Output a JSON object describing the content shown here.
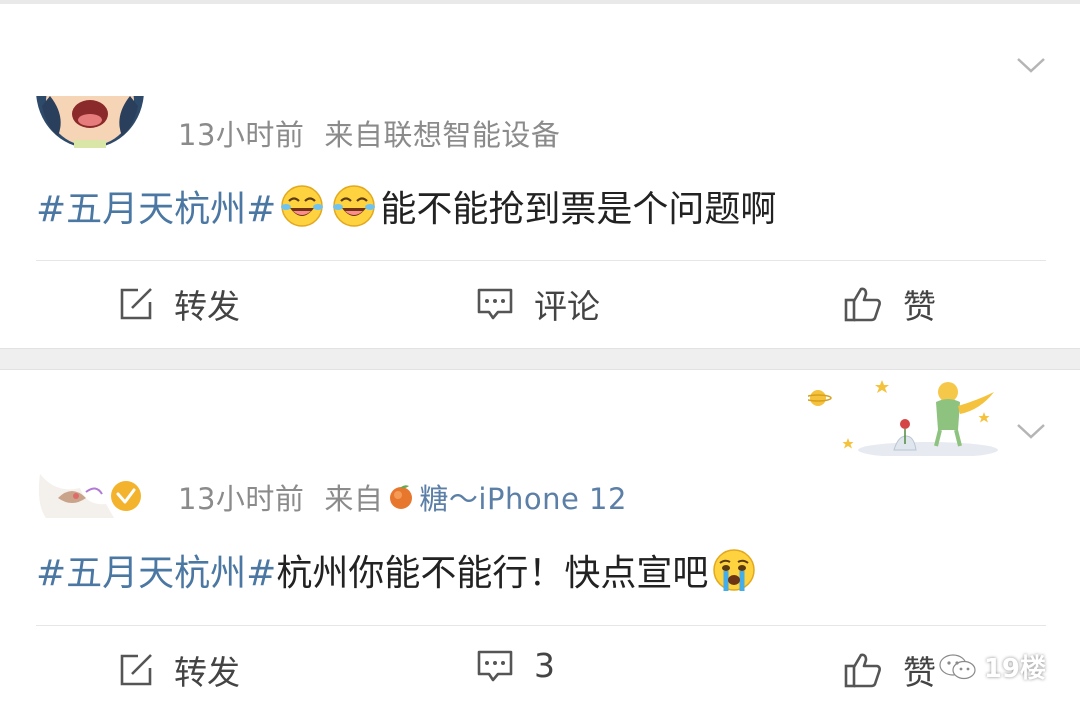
{
  "posts": [
    {
      "time": "13小时前",
      "source": "来自联想智能设备",
      "content": {
        "topic": "#五月天杭州#",
        "emojis": [
          "laugh-cry-emoji",
          "laugh-cry-emoji"
        ],
        "text": "能不能抢到票是个问题啊"
      },
      "actions": {
        "repost": "转发",
        "comment": "评论",
        "like": "赞"
      }
    },
    {
      "time": "13小时前",
      "source_prefix": "来自",
      "source_device": "糖～iPhone 12",
      "verified": true,
      "content": {
        "topic": "#五月天杭州#",
        "text": " 杭州你能不能行！快点宣吧",
        "emojis": [
          "crying-emoji"
        ]
      },
      "actions": {
        "repost": "转发",
        "comment": "3",
        "like": "赞"
      }
    }
  ],
  "watermark": {
    "label": "19楼",
    "icon": "wechat-icon"
  },
  "colors": {
    "topic": "#4b77a3",
    "meta": "#8b8b8b",
    "verified_badge": "#f4b32c",
    "separator": "#efefef"
  }
}
